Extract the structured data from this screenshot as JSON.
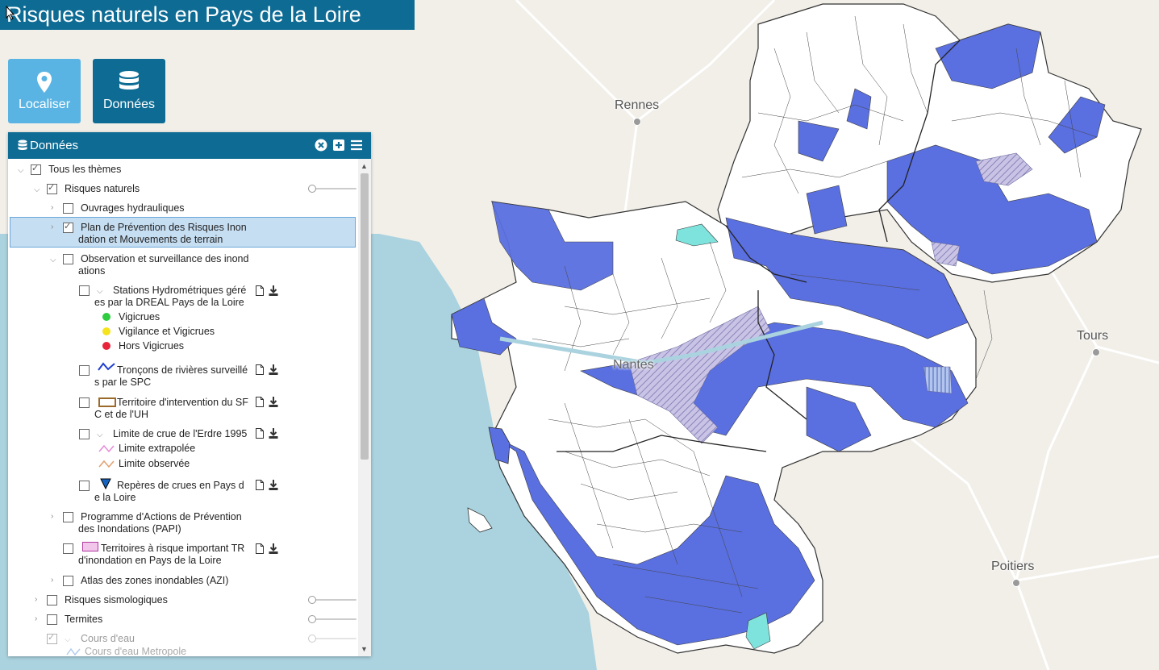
{
  "app": {
    "title": "Risques naturels en Pays de la Loire"
  },
  "mode_buttons": {
    "localiser": "Localiser",
    "donnees": "Données"
  },
  "panel": {
    "title": "Données",
    "tree": {
      "all_themes": "Tous les thèmes",
      "risques_naturels": "Risques naturels",
      "ouvrages": "Ouvrages hydrauliques",
      "ppri_l1": "Plan de Prévention des Risques Inon",
      "ppri_l2": "dation et Mouvements de terrain",
      "obs_l1": "Observation et surveillance des inond",
      "obs_l2": "ations",
      "stations_l1": "Stations Hydrométriques géré",
      "stations_l2": "es par la DREAL Pays de la Loire",
      "vigicrues": "Vigicrues",
      "vigilance": "Vigilance et Vigicrues",
      "hors": "Hors Vigicrues",
      "troncons_l1": "Tronçons de rivières surveillé",
      "troncons_l2": "s par le SPC",
      "territoire_l1": "Territoire d'intervention du SF",
      "territoire_l2": "C et de l'UH",
      "limite_l1": "Limite de crue de l'Erdre 1995",
      "limite_extra": "Limite extrapolée",
      "limite_obs": "Limite observée",
      "reperes_l1": "Repères de crues en Pays d",
      "reperes_l2": "e la Loire",
      "papi_l1": "Programme d'Actions de Prévention",
      "papi_l2": "des Inondations (PAPI)",
      "tri_l1": "Territoires à risque important TR",
      "tri_l2": "d'inondation en Pays de la Loire",
      "azi": "Atlas des zones inondables (AZI)",
      "sismo": "Risques sismologiques",
      "termites": "Termites",
      "cours_eau": "Cours d'eau",
      "cours_eau_metro": "Cours d'eau Metropole"
    }
  },
  "map": {
    "cities": {
      "rennes": "Rennes",
      "nantes": "Nantes",
      "tours": "Tours",
      "poitiers": "Poitiers"
    }
  },
  "colors": {
    "brand": "#0e6c94",
    "localiser": "#5ab4e3",
    "commune_fill": "#5a6fe0",
    "commune_cyan": "#7fe3dd",
    "vigicrues": "#2ecc40",
    "vigilance": "#f5e31b",
    "hors_vigicrues": "#e8243c"
  }
}
